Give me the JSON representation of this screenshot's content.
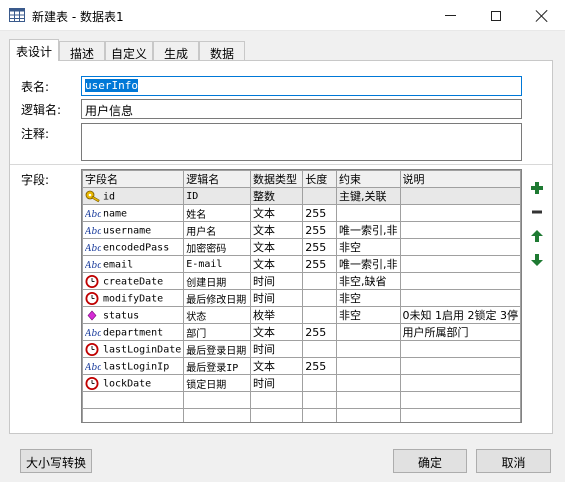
{
  "window": {
    "title": "新建表 - 数据表1"
  },
  "tabs": [
    "表设计",
    "描述",
    "自定义",
    "生成",
    "数据"
  ],
  "form": {
    "table_name_label": "表名:",
    "table_name_value": "userInfo",
    "logical_name_label": "逻辑名:",
    "logical_name_value": "用户信息",
    "comment_label": "注释:",
    "comment_value": "",
    "fields_label": "字段:"
  },
  "grid": {
    "headers": [
      "字段名",
      "逻辑名",
      "数据类型",
      "长度",
      "约束",
      "说明"
    ],
    "rows": [
      {
        "icon": "key",
        "name": "id",
        "logical": "ID",
        "type": "整数",
        "length": "",
        "constraint": "主键,关联",
        "desc": ""
      },
      {
        "icon": "text",
        "name": "name",
        "logical": "姓名",
        "type": "文本",
        "length": "255",
        "constraint": "",
        "desc": ""
      },
      {
        "icon": "text",
        "name": "username",
        "logical": "用户名",
        "type": "文本",
        "length": "255",
        "constraint": "唯一索引,非",
        "desc": ""
      },
      {
        "icon": "text",
        "name": "encodedPass",
        "logical": "加密密码",
        "type": "文本",
        "length": "255",
        "constraint": "非空",
        "desc": ""
      },
      {
        "icon": "text",
        "name": "email",
        "logical": "E-mail",
        "type": "文本",
        "length": "255",
        "constraint": "唯一索引,非",
        "desc": ""
      },
      {
        "icon": "clock",
        "name": "createDate",
        "logical": "创建日期",
        "type": "时间",
        "length": "",
        "constraint": "非空,缺省",
        "desc": ""
      },
      {
        "icon": "clock",
        "name": "modifyDate",
        "logical": "最后修改日期",
        "type": "时间",
        "length": "",
        "constraint": "非空",
        "desc": ""
      },
      {
        "icon": "enum",
        "name": "status",
        "logical": "状态",
        "type": "枚举",
        "length": "",
        "constraint": "非空",
        "desc": "0未知 1启用 2锁定 3停"
      },
      {
        "icon": "text",
        "name": "department",
        "logical": "部门",
        "type": "文本",
        "length": "255",
        "constraint": "",
        "desc": "用户所属部门"
      },
      {
        "icon": "clock",
        "name": "lastLoginDate",
        "logical": "最后登录日期",
        "type": "时间",
        "length": "",
        "constraint": "",
        "desc": ""
      },
      {
        "icon": "text",
        "name": "lastLoginIp",
        "logical": "最后登录IP",
        "type": "文本",
        "length": "255",
        "constraint": "",
        "desc": ""
      },
      {
        "icon": "clock",
        "name": "lockDate",
        "logical": "锁定日期",
        "type": "时间",
        "length": "",
        "constraint": "",
        "desc": ""
      }
    ]
  },
  "side_buttons": [
    "add-field-icon",
    "remove-field-icon",
    "move-up-icon",
    "move-down-icon"
  ],
  "buttons": {
    "case_convert": "大小写转换",
    "ok": "确定",
    "cancel": "取消"
  },
  "colors": {
    "accent": "#0078d7",
    "green": "#1e7a32",
    "clock_red": "#c00000"
  }
}
